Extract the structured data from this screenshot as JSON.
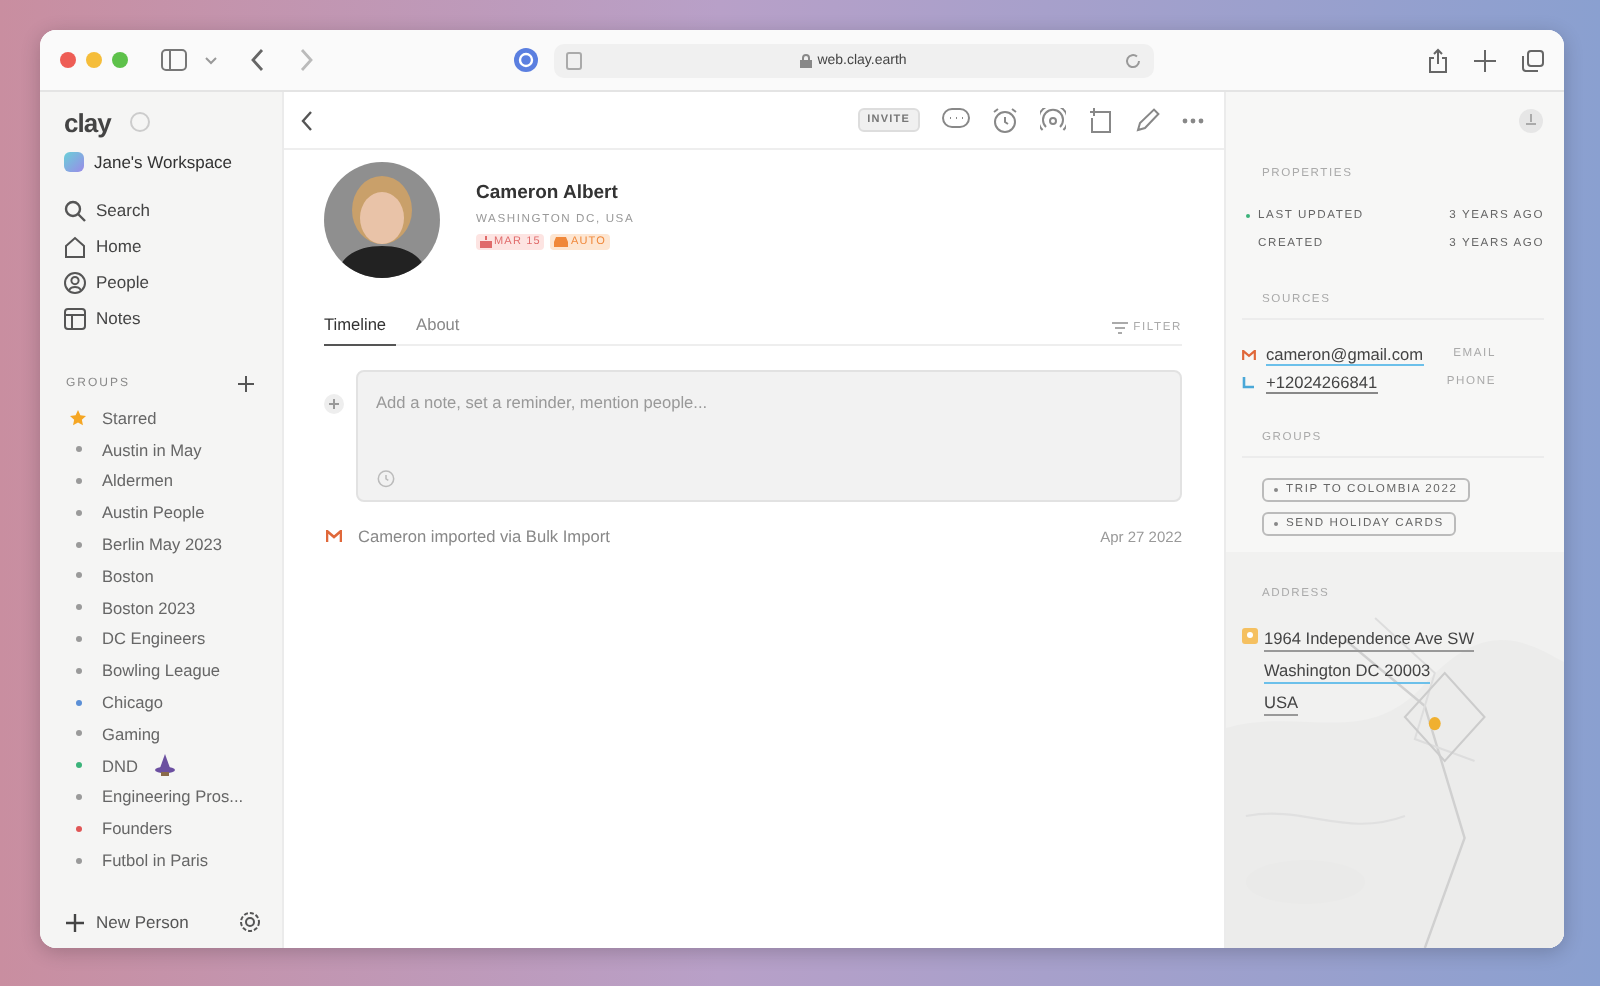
{
  "browser": {
    "url": "web.clay.earth"
  },
  "sidebar": {
    "logo": "clay",
    "workspace": "Jane's Workspace",
    "nav": [
      {
        "label": "Search",
        "kind": "search"
      },
      {
        "label": "Home",
        "kind": "home"
      },
      {
        "label": "People",
        "kind": "people"
      },
      {
        "label": "Notes",
        "kind": "notes"
      }
    ],
    "groups_heading": "GROUPS",
    "groups": [
      {
        "label": "Starred",
        "kind": "star",
        "color": "#f5a623"
      },
      {
        "label": "Austin in May",
        "kind": "dot",
        "color": "#9a9a9a"
      },
      {
        "label": "Aldermen",
        "kind": "dot",
        "color": "#9a9a9a"
      },
      {
        "label": "Austin People",
        "kind": "dot",
        "color": "#9a9a9a"
      },
      {
        "label": "Berlin May 2023",
        "kind": "dot",
        "color": "#9a9a9a"
      },
      {
        "label": "Boston",
        "kind": "dot",
        "color": "#9a9a9a"
      },
      {
        "label": "Boston 2023",
        "kind": "dot",
        "color": "#9a9a9a"
      },
      {
        "label": "DC Engineers",
        "kind": "dot",
        "color": "#9a9a9a"
      },
      {
        "label": "Bowling League",
        "kind": "dot",
        "color": "#9a9a9a"
      },
      {
        "label": "Chicago",
        "kind": "dot",
        "color": "#5b8fd6"
      },
      {
        "label": "Gaming",
        "kind": "dot",
        "color": "#9a9a9a"
      },
      {
        "label": "DND",
        "kind": "wizard",
        "color": "#3bb37a"
      },
      {
        "label": "Engineering Pros...",
        "kind": "dot",
        "color": "#9a9a9a"
      },
      {
        "label": "Founders",
        "kind": "dot",
        "color": "#e05656"
      },
      {
        "label": "Futbol in Paris",
        "kind": "dot",
        "color": "#9a9a9a"
      }
    ],
    "new_person": "New Person"
  },
  "main": {
    "invite": "INVITE",
    "person": {
      "name": "Cameron Albert",
      "location": "WASHINGTON DC, USA",
      "tags": [
        {
          "label": "MAR 15",
          "kind": "birthday"
        },
        {
          "label": "AUTO",
          "kind": "car"
        }
      ]
    },
    "tabs": [
      {
        "label": "Timeline",
        "selected": true
      },
      {
        "label": "About",
        "selected": false
      }
    ],
    "filter": "FILTER",
    "note_placeholder": "Add a note, set a reminder, mention people...",
    "timeline": [
      {
        "kind": "gmail",
        "text": "Cameron imported via Bulk Import",
        "date": "Apr 27 2022"
      }
    ]
  },
  "details": {
    "properties_heading": "PROPERTIES",
    "properties": [
      {
        "label": "LAST UPDATED",
        "value": "3 YEARS AGO",
        "highlighted": true
      },
      {
        "label": "CREATED",
        "value": "3 YEARS AGO",
        "highlighted": false
      }
    ],
    "sources_heading": "SOURCES",
    "sources": [
      {
        "kind": "gmail",
        "value": "cameron@gmail.com",
        "type": "EMAIL"
      },
      {
        "kind": "phone",
        "value": "+12024266841",
        "type": "PHONE"
      }
    ],
    "groups_heading": "GROUPS",
    "groups": [
      "TRIP TO COLOMBIA 2022",
      "SEND HOLIDAY CARDS"
    ],
    "address_heading": "ADDRESS",
    "address": [
      "1964 Independence Ave SW",
      "Washington DC 20003",
      "USA"
    ]
  }
}
